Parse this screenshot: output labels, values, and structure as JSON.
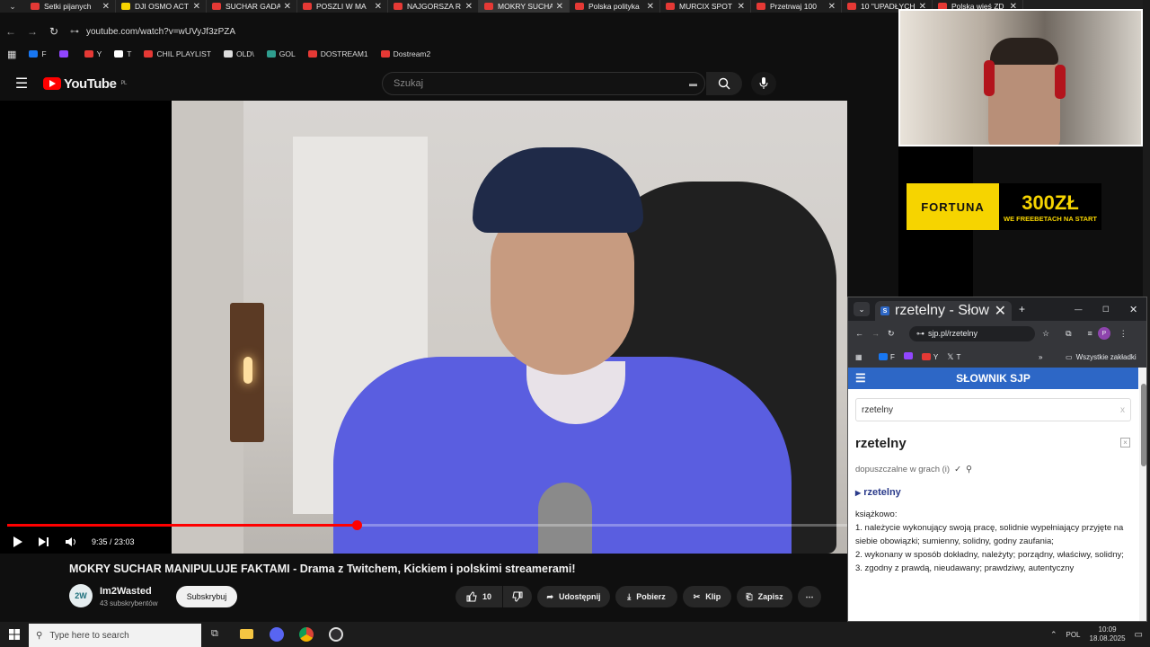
{
  "browser": {
    "tabs": [
      {
        "label": "Setki pijanych",
        "color": "#e53935",
        "active": false
      },
      {
        "label": "DJI OSMO ACT",
        "color": "#f6d400",
        "active": false
      },
      {
        "label": "SUCHAR GADA",
        "color": "#e53935",
        "active": false
      },
      {
        "label": "POSZLI W MA",
        "color": "#e53935",
        "active": false
      },
      {
        "label": "NAJGORSZA R",
        "color": "#e53935",
        "active": false
      },
      {
        "label": "MOKRY SUCHA",
        "color": "#e53935",
        "active": true
      },
      {
        "label": "Polska polityka",
        "color": "#e53935",
        "active": false
      },
      {
        "label": "MURCIX SPOT",
        "color": "#e53935",
        "active": false
      },
      {
        "label": "Przetrwaj 100",
        "color": "#e53935",
        "active": false
      },
      {
        "label": "10 \"UPADŁYCH",
        "color": "#e53935",
        "active": false
      },
      {
        "label": "Polska wieś ZD",
        "color": "#e53935",
        "active": false
      }
    ],
    "url": "youtube.com/watch?v=wUVyJf3zPZA",
    "bookmarks": [
      {
        "label": "F",
        "color": "#1877f2"
      },
      {
        "label": "",
        "color": "#9146ff"
      },
      {
        "label": "Y",
        "color": "#e53935"
      },
      {
        "label": "T",
        "color": "#ffffff"
      },
      {
        "label": "CHIL PLAYLIST",
        "color": "#e53935"
      },
      {
        "label": "OLD\\",
        "color": "#dddddd"
      },
      {
        "label": "GOL",
        "color": "#2f9e8f"
      },
      {
        "label": "DOSTREAM1",
        "color": "#e53935"
      },
      {
        "label": "Dostream2",
        "color": "#e53935"
      }
    ]
  },
  "youtube": {
    "logo_text": "YouTube",
    "logo_region": "PL",
    "search_placeholder": "Szukaj",
    "time": "9:35 / 23:03",
    "progress": 0.4163,
    "video_title": "MOKRY SUCHAR MANIPULUJE FAKTAMI - Drama z Twitchem, Kickiem i polskimi streamerami!",
    "channel_name": "Im2Wasted",
    "channel_subs": "43 subskrybentów",
    "subscribe_label": "Subskrybuj",
    "like_count": "10",
    "share_label": "Udostępnij",
    "download_label": "Pobierz",
    "clip_label": "Klip",
    "save_label": "Zapisz"
  },
  "ad": {
    "brand": "FORTUNA",
    "amount": "300ZŁ",
    "tagline": "WE FREEBETACH NA START"
  },
  "popup": {
    "tab_title": "rzetelny - Słownik SJP",
    "url": "sjp.pl/rzetelny",
    "bookmarks": [
      "F",
      "",
      "Y",
      "T"
    ],
    "bookmarks_all": "Wszystkie zakładki",
    "banner": "SŁOWNIK SJP",
    "search_value": "rzetelny",
    "headword": "rzetelny",
    "allowed": "dopuszczalne w grach (i)",
    "entry": "rzetelny",
    "register": "książkowo:",
    "def1": "1. należycie wykonujący swoją pracę, solidnie wypełniający przyjęte na siebie obowiązki; sumienny, solidny, godny zaufania;",
    "def2": "2. wykonany w sposób dokładny, należyty; porządny, właściwy, solidny;",
    "def3": "3. zgodny z prawdą, nieudawany; prawdziwy, autentyczny"
  },
  "taskbar": {
    "search_placeholder": "Type here to search",
    "lang": "POL",
    "time": "10:09",
    "date": "18.08.2025"
  }
}
